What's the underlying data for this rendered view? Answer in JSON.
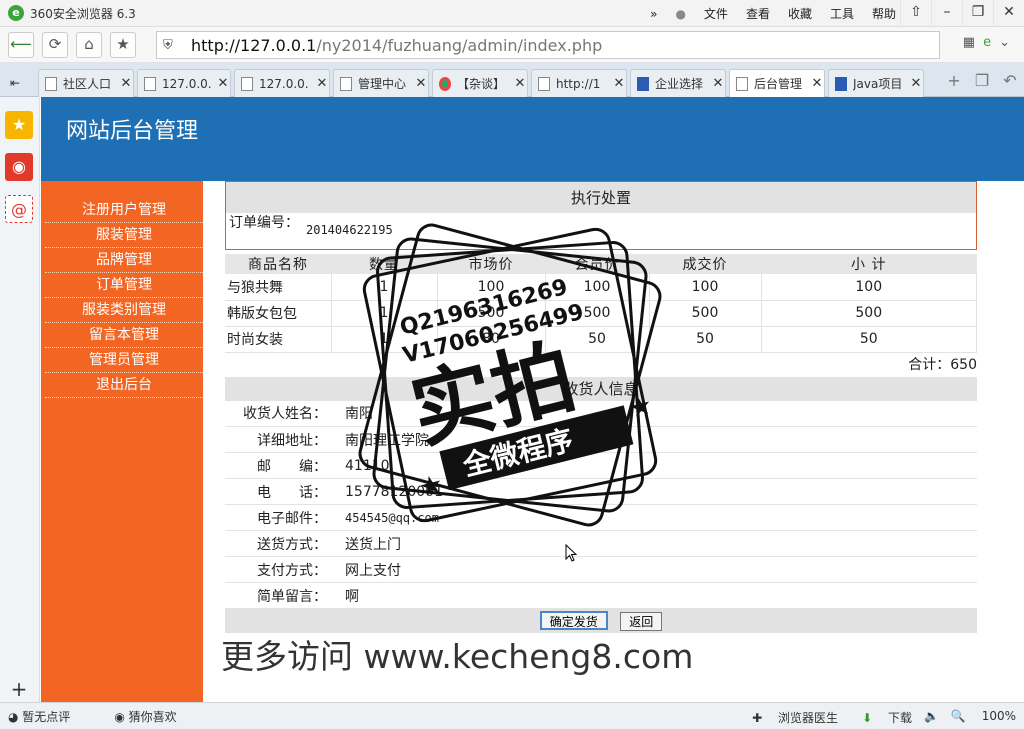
{
  "browser": {
    "title": "360安全浏览器 6.3",
    "menu": [
      "文件",
      "查看",
      "收藏",
      "工具",
      "帮助"
    ],
    "url_host": "http://127.0.0.1",
    "url_path": "/ny2014/fuzhuang/admin/index.php",
    "tabs": [
      {
        "label": "社区人口",
        "icon": "page-icon"
      },
      {
        "label": "127.0.0.",
        "icon": "page-icon"
      },
      {
        "label": "127.0.0.",
        "icon": "page-icon"
      },
      {
        "label": "管理中心",
        "icon": "page-icon"
      },
      {
        "label": "【杂谈】",
        "icon": "chrome-icon"
      },
      {
        "label": "http://1",
        "icon": "page-icon"
      },
      {
        "label": "企业选择",
        "icon": "paw-icon"
      },
      {
        "label": "后台管理",
        "icon": "page-icon"
      },
      {
        "label": "Java项目",
        "icon": "paw-icon"
      }
    ]
  },
  "site": {
    "title": "网站后台管理",
    "nav": [
      "注册用户管理",
      "服装管理",
      "品牌管理",
      "订单管理",
      "服装类别管理",
      "留言本管理",
      "管理员管理",
      "退出后台"
    ]
  },
  "order": {
    "section_title": "执行处置",
    "order_no_label": "订单编号：",
    "order_no": "201404622195",
    "columns": [
      "商品名称",
      "数量",
      "市场价",
      "会员价",
      "成交价",
      "小 计"
    ],
    "rows": [
      [
        "与狼共舞",
        "1",
        "100",
        "100",
        "100",
        "100"
      ],
      [
        "韩版女包包",
        "1",
        "500",
        "500",
        "500",
        "500"
      ],
      [
        "时尚女装",
        "1",
        "80",
        "50",
        "50",
        "50"
      ]
    ],
    "total": "合计：650"
  },
  "receiver": {
    "title": "收货人信息",
    "fields": [
      {
        "label": "收货人姓名：",
        "value": "南阳"
      },
      {
        "label": "详细地址：",
        "value": "南阳理工学院"
      },
      {
        "label": "邮　　编：",
        "value": "41110"
      },
      {
        "label": "电　　话：",
        "value": "15778120001"
      },
      {
        "label": "电子邮件：",
        "value": "454545@qq.com"
      },
      {
        "label": "送货方式：",
        "value": "送货上门"
      },
      {
        "label": "支付方式：",
        "value": "网上支付"
      },
      {
        "label": "简单留言：",
        "value": "啊"
      }
    ],
    "confirm_label": "确定发货",
    "back_label": "返回"
  },
  "watermark": {
    "line1": "Q2196316269",
    "line2": "V17060256499",
    "big": "实拍",
    "ribbon": "全微程序",
    "site": "更多访问 www.kecheng8.com"
  },
  "status": {
    "left": [
      "暂无点评",
      "猜你喜欢"
    ],
    "right": [
      "浏览器医生",
      "下载",
      "100%"
    ]
  }
}
